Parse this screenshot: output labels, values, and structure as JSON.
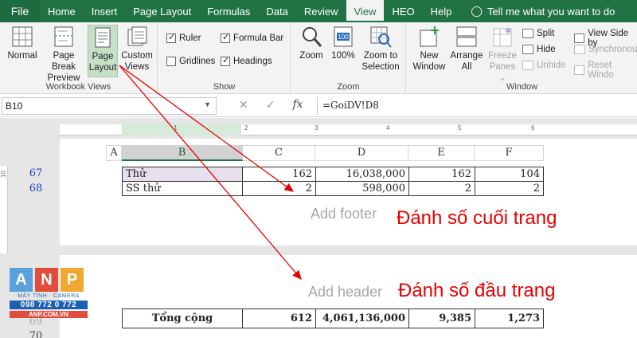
{
  "ribbon_tabs": [
    "File",
    "Home",
    "Insert",
    "Page Layout",
    "Formulas",
    "Data",
    "Review",
    "View",
    "HEO",
    "Help"
  ],
  "tell_me": "Tell me what you want to do",
  "workbook_views": {
    "normal": "Normal",
    "page_break_1": "Page Break",
    "page_break_2": "Preview",
    "page_layout_1": "Page",
    "page_layout_2": "Layout",
    "custom_1": "Custom",
    "custom_2": "Views",
    "label": "Workbook Views"
  },
  "show": {
    "ruler": "Ruler",
    "formula_bar": "Formula Bar",
    "gridlines": "Gridlines",
    "headings": "Headings",
    "label": "Show"
  },
  "zoom": {
    "zoom": "Zoom",
    "zoom100": "100%",
    "zoom_sel_1": "Zoom to",
    "zoom_sel_2": "Selection",
    "label": "Zoom",
    "badge": "100"
  },
  "window": {
    "new_1": "New",
    "new_2": "Window",
    "arrange_1": "Arrange",
    "arrange_2": "All",
    "freeze_1": "Freeze",
    "freeze_2": "Panes ⌄",
    "split": "Split",
    "hide": "Hide",
    "unhide": "Unhide",
    "view_side": "View Side by",
    "synchronous": "Synchronous",
    "reset": "Reset Windo",
    "label": "Window"
  },
  "formula_bar": {
    "name_box": "B10",
    "formula": "=GoiDV!D8",
    "fx": "fx"
  },
  "ruler_nums": [
    "1",
    "2",
    "3",
    "4",
    "5",
    "6"
  ],
  "vruler_num": "10",
  "columns": [
    "A",
    "B",
    "C",
    "D",
    "E",
    "F"
  ],
  "rows": [
    {
      "num": "67",
      "label": "Thử",
      "c": "162",
      "d": "16,038,000",
      "e": "162",
      "f": "104"
    },
    {
      "num": "68",
      "label": "SS thử",
      "c": "2",
      "d": "598,000",
      "e": "2",
      "f": "2"
    }
  ],
  "total_row": {
    "label": "Tổng cộng",
    "c": "612",
    "d": "4,061,136,000",
    "e": "9,385",
    "f": "1,273",
    "partial_row": "69",
    "next_row": "70"
  },
  "add_footer": "Add footer",
  "add_header": "Add header",
  "annotation_footer": "Đánh số cuối trang",
  "annotation_header": "Đánh số đầu trang",
  "logo": {
    "a": "A",
    "n": "N",
    "p": "P",
    "tagline": "MÁY TÍNH · CAMERA",
    "phone": "098 772 0 772",
    "web": "ANP.COM.VN"
  },
  "colors": {
    "excel_green": "#217346",
    "annotation_red": "#e60000",
    "row_number_blue": "#1a3fb5"
  }
}
